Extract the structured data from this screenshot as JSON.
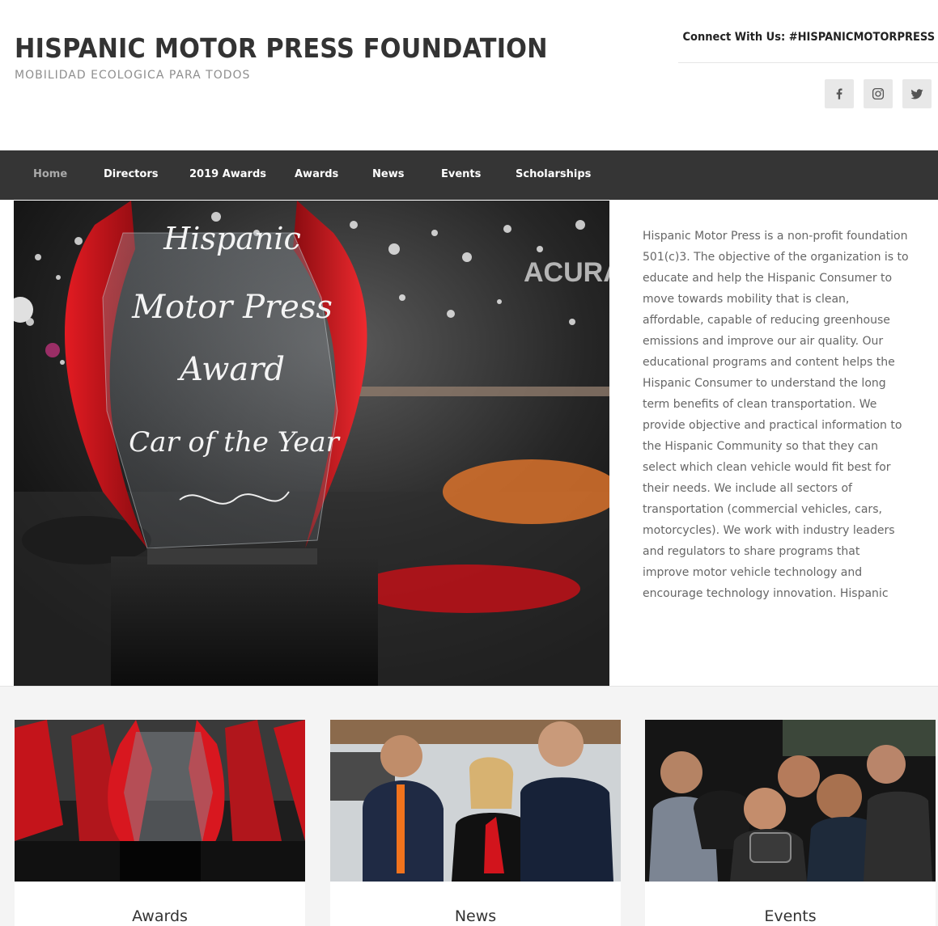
{
  "header": {
    "site_title": "HISPANIC MOTOR PRESS FOUNDATION",
    "tagline": "MOBILIDAD ECOLOGICA PARA TODOS",
    "connect": "Connect With Us: #HISPANICMOTORPRESS",
    "social": [
      {
        "icon": "facebook-icon"
      },
      {
        "icon": "instagram-icon"
      },
      {
        "icon": "twitter-icon"
      }
    ]
  },
  "nav": {
    "items": [
      {
        "label": "Home",
        "active": true
      },
      {
        "label": "Directors"
      },
      {
        "label": "2019 Awards"
      },
      {
        "label": "Awards"
      },
      {
        "label": "News"
      },
      {
        "label": "Events"
      },
      {
        "label": "Scholarships"
      }
    ]
  },
  "hero": {
    "trophy_lines": [
      "Hispanic",
      "Motor Press",
      "Award",
      "Car of the Year"
    ],
    "sign_text": "ACURA",
    "body": "Hispanic Motor Press is a non-profit foundation 501(c)3. The objective of the organization is to educate and help the Hispanic Consumer to move towards mobility that is clean, affordable, capable of reducing greenhouse emissions and improve our air quality. Our educational programs and content helps the Hispanic Consumer to understand the long term benefits of clean transportation. We provide objective and practical information to the Hispanic Community so that they can select which clean vehicle would fit best for their needs. We include all sectors of transportation (commercial vehicles, cars, motorcycles). We work with industry leaders and regulators to share programs that improve motor vehicle technology and encourage technology innovation. Hispanic"
  },
  "cards": [
    {
      "label": "Awards"
    },
    {
      "label": "News"
    },
    {
      "label": "Events"
    }
  ],
  "colors": {
    "nav_bg": "#353535",
    "accent_red": "#d0141c",
    "text_gray": "#666666"
  }
}
